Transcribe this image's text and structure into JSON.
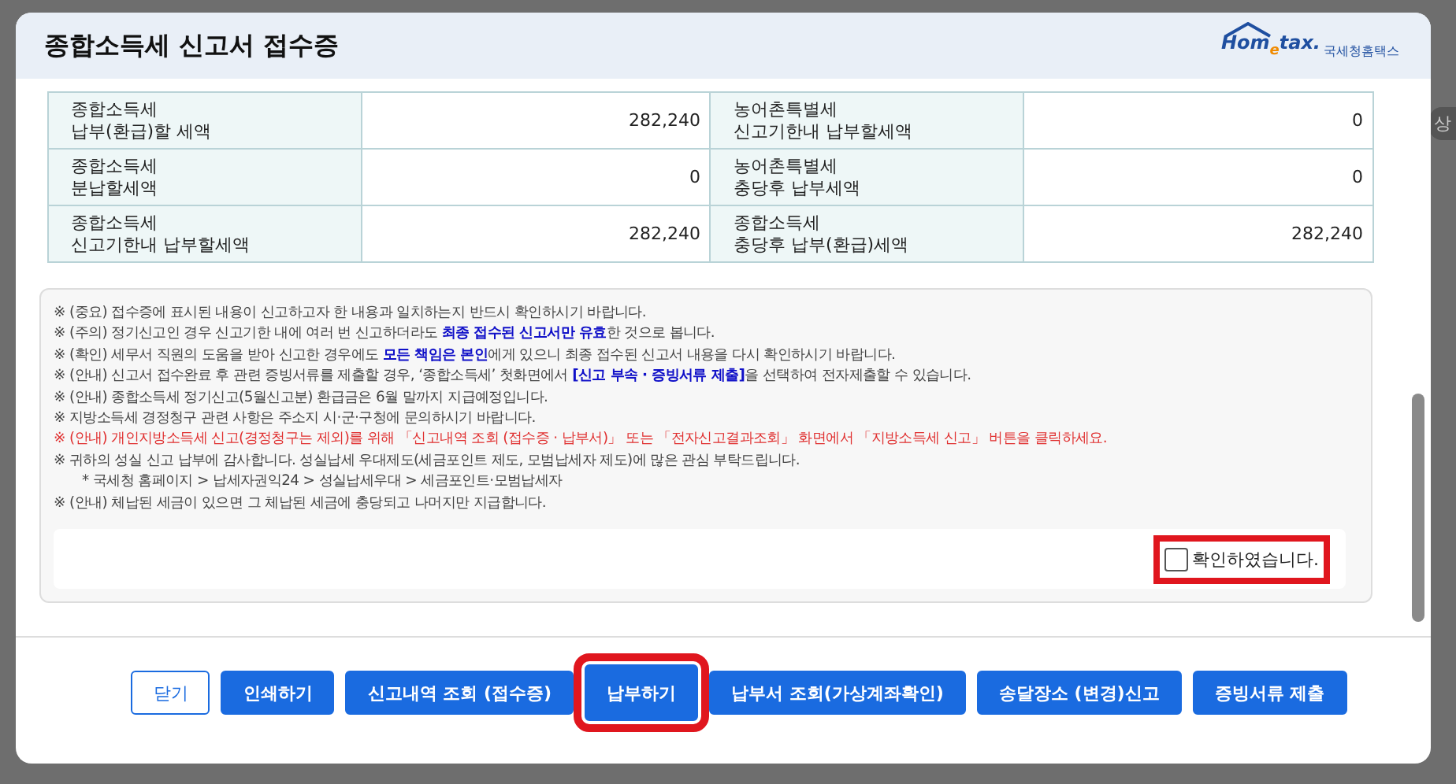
{
  "background": {
    "texts": [
      "상"
    ]
  },
  "window": {
    "title": "종합소득세 신고서 접수증",
    "logo": {
      "brand": "Hom",
      "brand_e": "e",
      "brand_tail": "tax.",
      "agency": "국세청홈택스"
    }
  },
  "table": {
    "rows": [
      {
        "cells": [
          {
            "kind": "label",
            "text": "종합소득세\n납부(환급)할 세액"
          },
          {
            "kind": "value",
            "text": "282,240"
          },
          {
            "kind": "label",
            "text": "농어촌특별세\n신고기한내 납부할세액"
          },
          {
            "kind": "value",
            "text": "0"
          }
        ]
      },
      {
        "cells": [
          {
            "kind": "label",
            "text": "종합소득세\n분납할세액"
          },
          {
            "kind": "value",
            "text": "0"
          },
          {
            "kind": "label",
            "text": "농어촌특별세\n충당후 납부세액"
          },
          {
            "kind": "value",
            "text": "0"
          }
        ]
      },
      {
        "cells": [
          {
            "kind": "label",
            "text": "종합소득세\n신고기한내 납부할세액"
          },
          {
            "kind": "value",
            "text": "282,240"
          },
          {
            "kind": "label",
            "text": "종합소득세\n충당후 납부(환급)세액"
          },
          {
            "kind": "value",
            "text": "282,240"
          }
        ]
      }
    ]
  },
  "notices": [
    {
      "kind": "normal",
      "text": "※ (중요) 접수증에 표시된 내용이 신고하고자 한 내용과 일치하는지 반드시 확인하시기 바랍니다."
    },
    {
      "kind": "normal",
      "text": "※ (주의) 정기신고인 경우 신고기한 내에 여러 번 신고하더라도 **최종 접수된 신고서만 유효**한 것으로 봅니다."
    },
    {
      "kind": "normal",
      "text": "※ (확인) 세무서 직원의 도움을 받아 신고한 경우에도 **모든 책임은 본인**에게 있으니 최종 접수된 신고서 내용을 다시 확인하시기 바랍니다."
    },
    {
      "kind": "normal",
      "text": "※ (안내) 신고서 접수완료 후 관련 증빙서류를 제출할 경우, ‘종합소득세’ 첫화면에서 **[신고 부속 · 증빙서류 제출]**을 선택하여 전자제출할 수 있습니다."
    },
    {
      "kind": "normal",
      "text": "※ (안내) 종합소득세 정기신고(5월신고분) 환급금은 6월 말까지 지급예정입니다."
    },
    {
      "kind": "normal",
      "text": "※ 지방소득세 경정청구 관련 사항은 주소지 시·군·구청에 문의하시기 바랍니다."
    },
    {
      "kind": "warning",
      "text": "※ (안내) 개인지방소득세 신고(경정청구는 제외)를 위해 「신고내역 조회 (접수증 · 납부서)」 또는 「전자신고결과조회」 화면에서 「지방소득세 신고」 버튼을 클릭하세요."
    },
    {
      "kind": "normal",
      "text": "※ 귀하의 성실 신고 납부에 감사합니다. 성실납세 우대제도(세금포인트 제도, 모범납세자 제도)에 많은 관심 부탁드립니다."
    },
    {
      "kind": "sub",
      "text": "* 국세청 홈페이지 > 납세자권익24 > 성실납세우대 > 세금포인트·모범납세자"
    },
    {
      "kind": "normal",
      "text": "※ (안내) 체납된 세금이 있으면 그 체납된 세금에 충당되고 나머지만 지급합니다."
    }
  ],
  "confirm": {
    "label": "확인하였습니다.",
    "checked": false,
    "highlighted": true
  },
  "buttons": [
    {
      "label": "닫기",
      "kind": "outline",
      "highlighted": false
    },
    {
      "label": "인쇄하기",
      "kind": "primary",
      "highlighted": false
    },
    {
      "label": "신고내역 조회 (접수증)",
      "kind": "primary",
      "highlighted": false
    },
    {
      "label": "납부하기",
      "kind": "primary",
      "highlighted": true
    },
    {
      "label": "납부서 조회(가상계좌확인)",
      "kind": "primary",
      "highlighted": false
    },
    {
      "label": "송달장소 (변경)신고",
      "kind": "primary",
      "highlighted": false
    },
    {
      "label": "증빙서류 제출",
      "kind": "primary",
      "highlighted": false
    }
  ]
}
